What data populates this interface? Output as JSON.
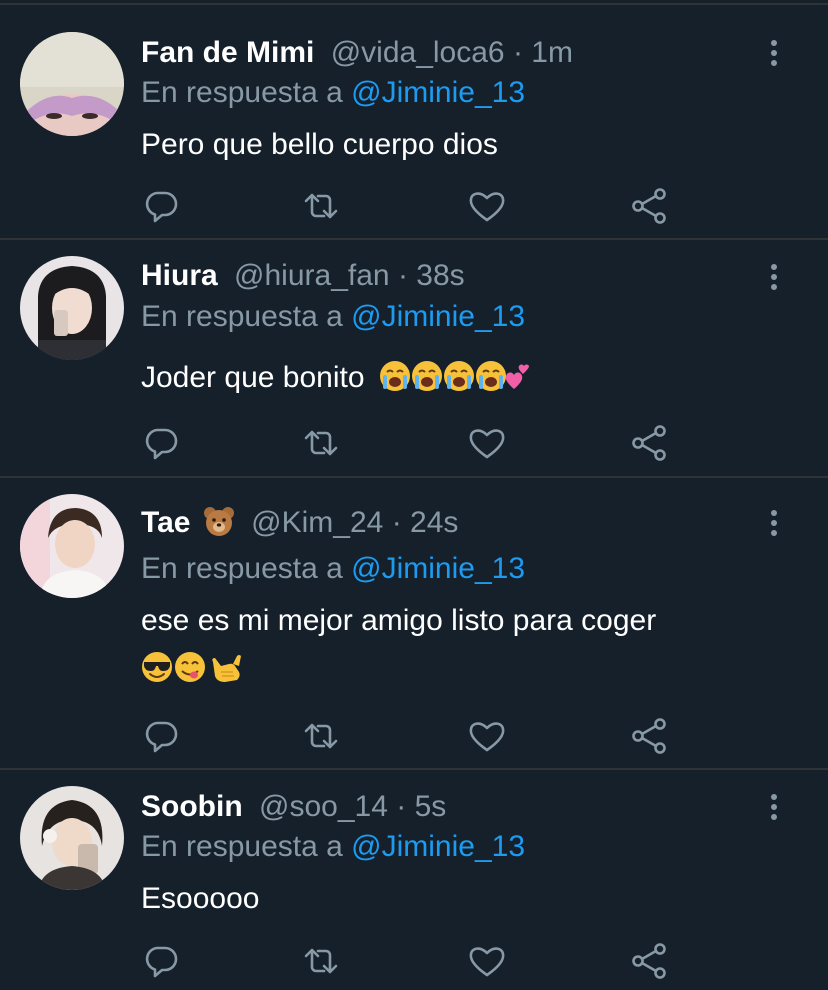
{
  "colors": {
    "background": "#15202b",
    "divider": "#2f3336",
    "primary_text": "#ffffff",
    "secondary_text": "#8899a6",
    "mention": "#1d9bf0"
  },
  "icons": {
    "more": "more-vertical-icon",
    "reply": "reply-icon",
    "retweet": "retweet-icon",
    "like": "heart-icon",
    "share": "share-icon"
  },
  "replies": [
    {
      "name": "Fan de Mimi",
      "name_emoji": "",
      "handle": "@vida_loca6",
      "separator": "·",
      "time": "1m",
      "reply_prefix": "En respuesta a",
      "reply_to": "@Jiminie_13",
      "text": "Pero que bello cuerpo dios",
      "emojis": []
    },
    {
      "name": "Hiura",
      "name_emoji": "",
      "handle": "@hiura_fan",
      "separator": "·",
      "time": "38s",
      "reply_prefix": "En respuesta a",
      "reply_to": "@Jiminie_13",
      "text": "Joder que bonito",
      "emojis": [
        "loudly-crying-face",
        "loudly-crying-face",
        "loudly-crying-face",
        "loudly-crying-face",
        "two-hearts"
      ]
    },
    {
      "name": "Tae",
      "name_emoji": "bear-face",
      "handle": "@Kim_24",
      "separator": "·",
      "time": "24s",
      "reply_prefix": "En respuesta a",
      "reply_to": "@Jiminie_13",
      "text": "ese es mi mejor amigo listo para coger",
      "emojis": [
        "smiling-face-with-sunglasses",
        "face-savoring-food",
        "call-me-hand"
      ]
    },
    {
      "name": "Soobin",
      "name_emoji": "",
      "handle": "@soo_14",
      "separator": "·",
      "time": "5s",
      "reply_prefix": "En respuesta a",
      "reply_to": "@Jiminie_13",
      "text": "Esooooo",
      "emojis": []
    }
  ]
}
